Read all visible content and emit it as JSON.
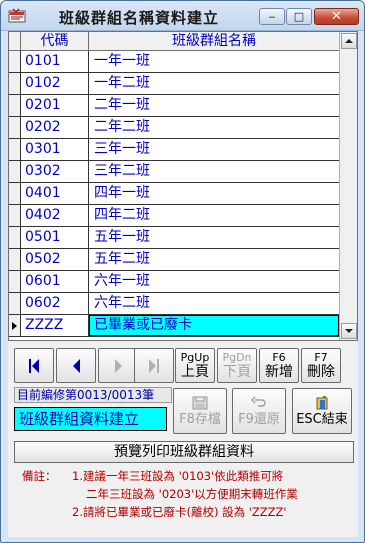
{
  "window": {
    "title": "班級群組名稱資料建立",
    "min_symbol": "‒",
    "max_symbol": "□",
    "close_symbol": "✕"
  },
  "grid": {
    "columns": [
      "代碼",
      "班級群組名稱"
    ],
    "rows": [
      {
        "code": "0101",
        "name": "一年一班"
      },
      {
        "code": "0102",
        "name": "一年二班"
      },
      {
        "code": "0201",
        "name": "二年一班"
      },
      {
        "code": "0202",
        "name": "二年二班"
      },
      {
        "code": "0301",
        "name": "三年一班"
      },
      {
        "code": "0302",
        "name": "三年二班"
      },
      {
        "code": "0401",
        "name": "四年一班"
      },
      {
        "code": "0402",
        "name": "四年二班"
      },
      {
        "code": "0501",
        "name": "五年一班"
      },
      {
        "code": "0502",
        "name": "五年二班"
      },
      {
        "code": "0601",
        "name": "六年一班"
      },
      {
        "code": "0602",
        "name": "六年二班"
      },
      {
        "code": "ZZZZ",
        "name": "已畢業或已廢卡"
      }
    ],
    "current_row": 12
  },
  "nav": {
    "pgup_key": "PgUp",
    "pgup_label": "上頁",
    "pgdn_key": "PgDn",
    "pgdn_label": "下頁",
    "f6_key": "F6",
    "f6_label": "新增",
    "f7_key": "F7",
    "f7_label": "刪除"
  },
  "status": {
    "record_text": "目前編修第0013/0013筆",
    "form_title": "班級群組資料建立"
  },
  "actions": {
    "save_label": "F8存檔",
    "restore_label": "F9還原",
    "exit_label": "ESC結束",
    "preview_label": "預覽列印班級群組資料"
  },
  "notes": {
    "label": "備註：",
    "line1": "1.建議一年三班設為 '0103'依此類推可將",
    "line2": "二年三班設為 '0203'以方便期末轉班作業",
    "line3": "2.請將已畢業或已廢卡(離校) 設為 'ZZZZ'"
  },
  "colors": {
    "highlight": "#00ffff",
    "text_blue": "#0000c8",
    "note_red": "#b00000"
  }
}
